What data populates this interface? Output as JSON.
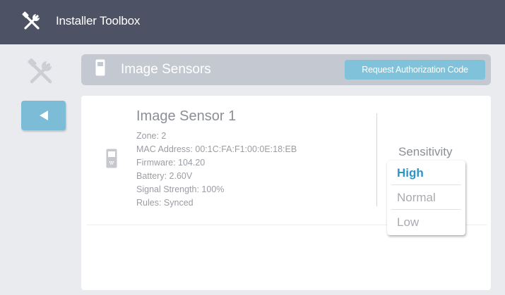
{
  "app": {
    "title": "Installer Toolbox",
    "icon": "tools-icon"
  },
  "header": {
    "title": "Image Sensors",
    "icon": "sensor-device-icon",
    "auth_button_label": "Request Authorization Code"
  },
  "nav": {
    "side_icon": "tools-icon",
    "back_icon": "back-arrow-icon"
  },
  "sensor": {
    "name": "Image Sensor 1",
    "zone": "Zone: 2",
    "mac": "MAC Address: 00:1C:FA:F1:00:0E:18:EB",
    "firmware": "Firmware: 104.20",
    "battery": "Battery: 2.60V",
    "signal": "Signal Strength: 100%",
    "rules": "Rules: Synced"
  },
  "sensitivity": {
    "label": "Sensitivity",
    "options": [
      "High",
      "Normal",
      "Low"
    ],
    "selected": "High"
  },
  "colors": {
    "titlebar": "#4d5264",
    "accent": "#80c2da",
    "selected_option": "#2f95c4",
    "background": "#eaebef"
  }
}
